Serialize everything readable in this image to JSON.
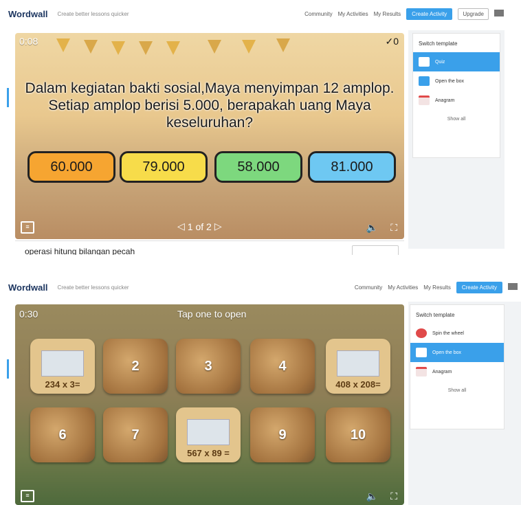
{
  "colors": {
    "accent": "#3aa0ea",
    "brand": "#1d3660"
  },
  "header": {
    "logo": "Wordwall",
    "tagline": "Create better lessons quicker",
    "community": "Community",
    "my_activities": "My Activities",
    "my_results": "My Results",
    "create_activity": "Create Activity",
    "upgrade": "Upgrade"
  },
  "shot1": {
    "timer": "0:08",
    "score": "✓0",
    "question": "Dalam kegiatan bakti sosial,Maya menyimpan 12 amplop. Setiap amplop berisi 5.000, berapakah uang Maya keseluruhan?",
    "answers": [
      {
        "label": "60.000",
        "color": "#f6a531"
      },
      {
        "label": "79.000",
        "color": "#f7dc4a"
      },
      {
        "label": "58.000",
        "color": "#7dd87e"
      },
      {
        "label": "81.000",
        "color": "#6ec8f2"
      }
    ],
    "page_indicator": "1 of 2",
    "activity_title": "operasi hitung bilangan pecah",
    "sidebar": {
      "title": "Switch template",
      "items": [
        "Quiz",
        "Open the box",
        "Anagram"
      ],
      "show_all": "Show all"
    }
  },
  "shot2": {
    "timer": "0:30",
    "instruction": "Tap one to open",
    "tiles": [
      {
        "label": "234 x 3=",
        "open": true
      },
      {
        "label": "2",
        "open": false
      },
      {
        "label": "3",
        "open": false
      },
      {
        "label": "4",
        "open": false
      },
      {
        "label": "408 x 208=",
        "open": true
      },
      {
        "label": "6",
        "open": false
      },
      {
        "label": "7",
        "open": false
      },
      {
        "label": "567 x 89 =",
        "open": true
      },
      {
        "label": "9",
        "open": false
      },
      {
        "label": "10",
        "open": false
      }
    ],
    "sidebar": {
      "title": "Switch template",
      "items": [
        "Spin the wheel",
        "Open the box",
        "Anagram"
      ],
      "show_all": "Show all"
    }
  }
}
